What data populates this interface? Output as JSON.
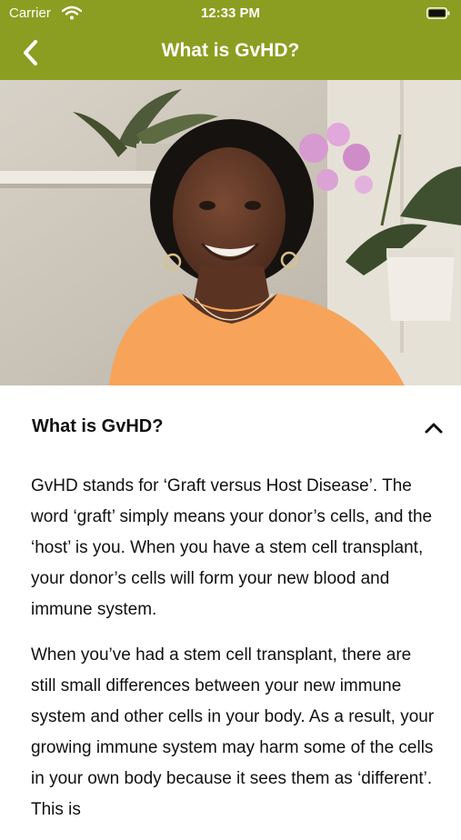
{
  "status_bar": {
    "carrier": "Carrier",
    "time": "12:33 PM"
  },
  "nav": {
    "title": "What is GvHD?",
    "back_icon": "chevron-left-icon"
  },
  "colors": {
    "header": "#8c9e21",
    "text": "#111111",
    "shirt": "#f7a45a"
  },
  "hero_image": {
    "subject": "smiling-woman-orange-top"
  },
  "section": {
    "title": "What is GvHD?",
    "toggle_icon": "chevron-up-icon",
    "paragraphs": [
      "GvHD stands for ‘Graft versus Host Disease’. The word ‘graft’ simply means your donor’s cells, and the ‘host’ is you. When you have a stem cell transplant, your donor’s cells will form your new blood and immune system.",
      "When you’ve had a stem cell transplant, there are still small differences between your new immune system and other cells in your body. As a result, your growing immune system may harm some of the cells in your own body because it sees them as ‘different’. This is"
    ]
  }
}
